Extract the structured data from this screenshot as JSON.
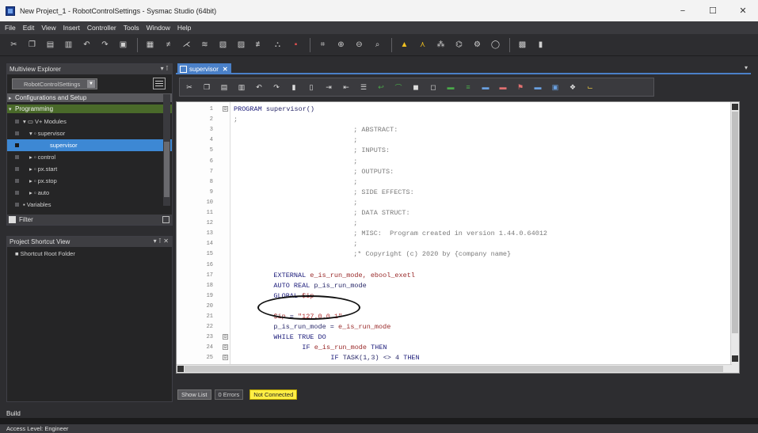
{
  "window": {
    "title": "New Project_1 - RobotControlSettings - Sysmac Studio (64bit)",
    "controls": [
      "−",
      "☐",
      "✕"
    ]
  },
  "menu": [
    "File",
    "Edit",
    "View",
    "Insert",
    "Controller",
    "Tools",
    "Window",
    "Help"
  ],
  "toolbar_icons": [
    "cut-icon",
    "copy-icon",
    "paste-icon",
    "delete-icon",
    "undo-icon",
    "redo-icon",
    "download-icon",
    "simulator-icon",
    "online-icon",
    "offline-icon",
    "compare-icon",
    "sync-icon",
    "build-icon",
    "monitor-icon",
    "breakpoint-icon",
    "zoom-out-icon",
    "zoom-in-icon",
    "find-icon",
    "warning-icon",
    "cross-ref-icon",
    "watch-icon",
    "reset-icon",
    "settings-icon",
    "panel-icon",
    "layout-icon"
  ],
  "explorer": {
    "title": "Multiview Explorer",
    "device": "RobotControlSettings",
    "sections": {
      "config": "Configurations and Setup",
      "programming": "Programming"
    },
    "tree": [
      {
        "label": "▾ ▭ V+ Modules",
        "indent": 20
      },
      {
        "label": "▾ ▫ supervisor",
        "indent": 28
      },
      {
        "label": "supervisor",
        "indent": 54,
        "selected": true
      },
      {
        "label": "▸ ▫ control",
        "indent": 28
      },
      {
        "label": "▸ ▫ px.start",
        "indent": 28
      },
      {
        "label": "▸ ▫ px.stop",
        "indent": 28
      },
      {
        "label": "▸ ▫ auto",
        "indent": 28
      },
      {
        "label": "▪ Variables",
        "indent": 20
      }
    ],
    "filter_label": "Filter"
  },
  "shortcut_view": {
    "title": "Project Shortcut View",
    "root": "■ Shortcut Root Folder"
  },
  "editor": {
    "tab_label": "supervisor",
    "lines": [
      {
        "n": "1",
        "fold": "⊟",
        "indent": 0,
        "parts": [
          {
            "c": "kw",
            "t": "PROGRAM"
          },
          {
            "c": "tx",
            "t": " supervisor()"
          }
        ]
      },
      {
        "n": "2",
        "fold": "",
        "indent": 0,
        "parts": [
          {
            "c": "cm",
            "t": ";"
          }
        ]
      },
      {
        "n": "3",
        "fold": "",
        "indent": 42,
        "parts": [
          {
            "c": "cm",
            "t": "; ABSTRACT:"
          }
        ]
      },
      {
        "n": "4",
        "fold": "",
        "indent": 42,
        "parts": [
          {
            "c": "cm",
            "t": ";"
          }
        ]
      },
      {
        "n": "5",
        "fold": "",
        "indent": 42,
        "parts": [
          {
            "c": "cm",
            "t": "; INPUTS:"
          }
        ]
      },
      {
        "n": "6",
        "fold": "",
        "indent": 42,
        "parts": [
          {
            "c": "cm",
            "t": ";"
          }
        ]
      },
      {
        "n": "7",
        "fold": "",
        "indent": 42,
        "parts": [
          {
            "c": "cm",
            "t": "; OUTPUTS:"
          }
        ]
      },
      {
        "n": "8",
        "fold": "",
        "indent": 42,
        "parts": [
          {
            "c": "cm",
            "t": ";"
          }
        ]
      },
      {
        "n": "9",
        "fold": "",
        "indent": 42,
        "parts": [
          {
            "c": "cm",
            "t": "; SIDE EFFECTS:"
          }
        ]
      },
      {
        "n": "10",
        "fold": "",
        "indent": 42,
        "parts": [
          {
            "c": "cm",
            "t": ";"
          }
        ]
      },
      {
        "n": "11",
        "fold": "",
        "indent": 42,
        "parts": [
          {
            "c": "cm",
            "t": "; DATA STRUCT:"
          }
        ]
      },
      {
        "n": "12",
        "fold": "",
        "indent": 42,
        "parts": [
          {
            "c": "cm",
            "t": ";"
          }
        ]
      },
      {
        "n": "13",
        "fold": "",
        "indent": 42,
        "parts": [
          {
            "c": "cm",
            "t": "; MISC:  Program created in version 1.44.0.64012"
          }
        ]
      },
      {
        "n": "14",
        "fold": "",
        "indent": 42,
        "parts": [
          {
            "c": "cm",
            "t": ";"
          }
        ]
      },
      {
        "n": "15",
        "fold": "",
        "indent": 42,
        "parts": [
          {
            "c": "cm",
            "t": ";* Copyright (c) 2020 by {company name}"
          }
        ]
      },
      {
        "n": "16",
        "fold": "",
        "indent": 0,
        "parts": []
      },
      {
        "n": "17",
        "fold": "",
        "indent": 14,
        "parts": [
          {
            "c": "kw",
            "t": "EXTERNAL"
          },
          {
            "c": "vr",
            "t": " e_is_run_mode, ebool_exetl"
          }
        ]
      },
      {
        "n": "18",
        "fold": "",
        "indent": 14,
        "parts": [
          {
            "c": "kw",
            "t": "AUTO REAL"
          },
          {
            "c": "tx",
            "t": " p_is_run_mode"
          }
        ]
      },
      {
        "n": "19",
        "fold": "",
        "indent": 14,
        "parts": [
          {
            "c": "kw",
            "t": "GLOBAL"
          },
          {
            "c": "vr",
            "t": " $ip"
          }
        ]
      },
      {
        "n": "20",
        "fold": "",
        "indent": 0,
        "parts": []
      },
      {
        "n": "21",
        "fold": "",
        "indent": 14,
        "parts": [
          {
            "c": "vr",
            "t": "$ip"
          },
          {
            "c": "tx",
            "t": " = "
          },
          {
            "c": "st",
            "t": "\"127.0.0.1\""
          }
        ]
      },
      {
        "n": "22",
        "fold": "",
        "indent": 14,
        "parts": [
          {
            "c": "tx",
            "t": "p_is_run_mode = "
          },
          {
            "c": "vr",
            "t": "e_is_run_mode"
          }
        ]
      },
      {
        "n": "23",
        "fold": "⊟",
        "indent": 14,
        "parts": [
          {
            "c": "kw",
            "t": "WHILE TRUE DO"
          }
        ]
      },
      {
        "n": "24",
        "fold": "⊟",
        "indent": 24,
        "parts": [
          {
            "c": "kw",
            "t": "IF"
          },
          {
            "c": "vr",
            "t": " e_is_run_mode"
          },
          {
            "c": "kw",
            "t": " THEN"
          }
        ]
      },
      {
        "n": "25",
        "fold": "⊟",
        "indent": 34,
        "parts": [
          {
            "c": "kw",
            "t": "IF"
          },
          {
            "c": "tx",
            "t": " TASK(1,3) <> 4 "
          },
          {
            "c": "kw",
            "t": "THEN"
          }
        ]
      }
    ]
  },
  "status": {
    "show_list": "Show List",
    "errors": "0 Errors",
    "connection": "Not Connected"
  },
  "bottom": {
    "build": "Build",
    "access_level": "Access Level: Engineer"
  }
}
